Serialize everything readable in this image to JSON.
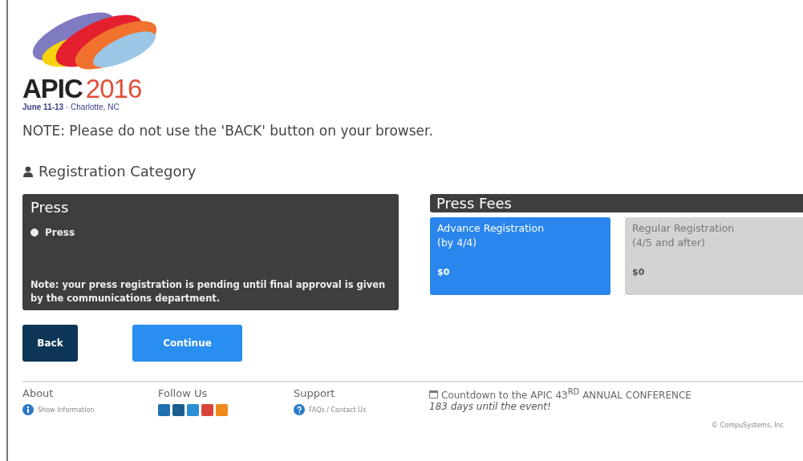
{
  "logo": {
    "wordmark": "APIC",
    "year": "2016",
    "tagline": "**June 11-13** · Charlotte, NC"
  },
  "note": "NOTE: Please do not use the 'BACK' button on your browser.",
  "section_title": "Registration Category",
  "category_panel": {
    "title": "Press",
    "options": [
      {
        "label": "Press",
        "selected": true
      }
    ],
    "note": "Note: your press registration is pending until final approval is given by the communications department."
  },
  "fees_panel": {
    "title": "Press Fees",
    "options": [
      {
        "name": "Advance Registration",
        "period": "(by 4/4)",
        "price": "$0",
        "selected": true
      },
      {
        "name": "Regular Registration",
        "period": "(4/5 and after)",
        "price": "$0",
        "selected": false
      }
    ]
  },
  "buttons": [
    {
      "label": "Back",
      "kind": "secondary"
    },
    {
      "label": "Continue",
      "kind": "primary"
    }
  ],
  "footer": {
    "columns": [
      {
        "heading": "About",
        "link": "Show Information",
        "kind": "info"
      },
      {
        "heading": "Follow Us",
        "kind": "social"
      },
      {
        "heading": "Support",
        "link": "FAQs / Contact Us",
        "kind": "help"
      }
    ],
    "countdown": "Countdown to the APIC 43$^{RD}$ ANNUAL CONFERENCE",
    "days": "183 days until the event!",
    "copyright": "© CompuSystems, Inc"
  }
}
